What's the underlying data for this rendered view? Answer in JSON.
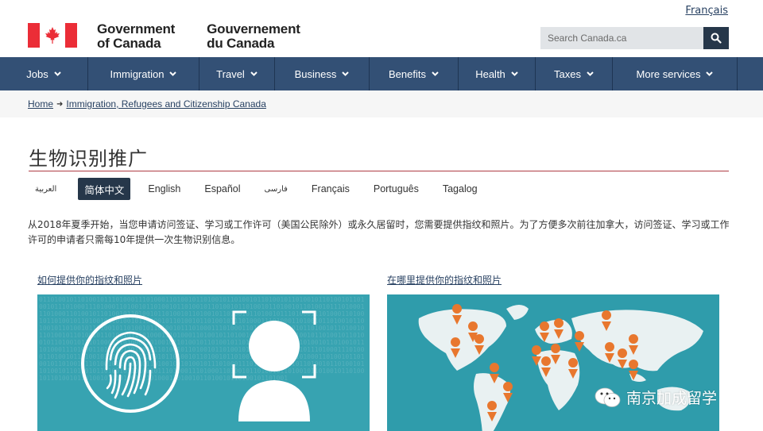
{
  "header": {
    "language_toggle": "Français",
    "brand_en": [
      "Government",
      "of Canada"
    ],
    "brand_fr": [
      "Gouvernement",
      "du Canada"
    ],
    "search_placeholder": "Search Canada.ca",
    "search_icon": "search-icon"
  },
  "nav": {
    "items": [
      {
        "label": "Jobs"
      },
      {
        "label": "Immigration"
      },
      {
        "label": "Travel"
      },
      {
        "label": "Business"
      },
      {
        "label": "Benefits"
      },
      {
        "label": "Health"
      },
      {
        "label": "Taxes"
      },
      {
        "label": "More services"
      }
    ]
  },
  "breadcrumb": {
    "items": [
      "Home",
      "Immigration, Refugees and Citizenship Canada"
    ]
  },
  "page": {
    "title": "生物识别推广",
    "languages": [
      {
        "label": "العربية",
        "active": false
      },
      {
        "label": "简体中文",
        "active": true
      },
      {
        "label": "English",
        "active": false
      },
      {
        "label": "Español",
        "active": false
      },
      {
        "label": "فارسی",
        "active": false
      },
      {
        "label": "Français",
        "active": false
      },
      {
        "label": "Português",
        "active": false
      },
      {
        "label": "Tagalog",
        "active": false
      }
    ],
    "intro": "从2018年夏季开始，当您申请访问签证、学习或工作许可（美国公民除外）或永久居留时，您需要提供指纹和照片。为了方便多次前往加拿大，访问签证、学习或工作许可的申请者只需每10年提供一次生物识别信息。"
  },
  "cards": {
    "left": {
      "link": "如何提供你的指纹和照片"
    },
    "right": {
      "link": "在哪里提供你的指纹和照片"
    }
  },
  "watermark": {
    "text": "南京加成留学",
    "icon": "wechat-icon"
  },
  "colors": {
    "nav_bg": "#335075",
    "accent_red": "#eb2d37",
    "rule_red": "#af3c43",
    "panel_teal": "#37a3b1",
    "pin_orange": "#e8772e"
  }
}
